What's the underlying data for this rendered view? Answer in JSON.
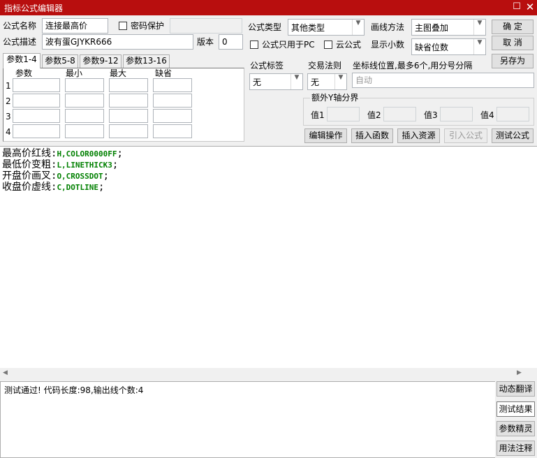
{
  "window": {
    "title": "指标公式编辑器"
  },
  "form": {
    "name_label": "公式名称",
    "name_value": "连接最高价",
    "password_label": "密码保护",
    "desc_label": "公式描述",
    "desc_value": "波有蛋GJYKR666",
    "version_label": "版本",
    "version_value": "0",
    "type_label": "公式类型",
    "type_value": "其他类型",
    "draw_label": "画线方法",
    "draw_value": "主图叠加",
    "pc_only_label": "公式只用于PC",
    "cloud_label": "云公式",
    "decimals_label": "显示小数",
    "decimals_value": "缺省位数",
    "tag_label": "公式标签",
    "tag_value": "无",
    "trade_label": "交易法则",
    "trade_value": "无",
    "coord_label": "坐标线位置,最多6个,用分号分隔",
    "coord_placeholder": "自动",
    "yaxis_label": "额外Y轴分界",
    "val1": "值1",
    "val2": "值2",
    "val3": "值3",
    "val4": "值4"
  },
  "buttons": {
    "ok": "确  定",
    "cancel": "取  消",
    "save_as": "另存为",
    "edit_op": "编辑操作",
    "insert_func": "插入函数",
    "insert_res": "插入资源",
    "import": "引入公式",
    "test": "测试公式"
  },
  "tabs": [
    "参数1-4",
    "参数5-8",
    "参数9-12",
    "参数13-16"
  ],
  "params": {
    "headers": [
      "参数",
      "最小",
      "最大",
      "缺省"
    ],
    "rows": [
      "1",
      "2",
      "3",
      "4"
    ]
  },
  "code": [
    {
      "name": "最高价红线",
      "sep": ":",
      "val": "H,COLOR0000FF",
      "end": ";"
    },
    {
      "name": "最低价变粗",
      "sep": ":",
      "val": "L,LINETHICK3",
      "end": ";"
    },
    {
      "name": "开盘价画叉",
      "sep": ":",
      "val": "O,CROSSDOT",
      "end": ";"
    },
    {
      "name": "收盘价虚线",
      "sep": ":",
      "val": "C,DOTLINE",
      "end": ";"
    }
  ],
  "result": {
    "text": "测试通过! 代码长度:98,输出线个数:4"
  },
  "side": [
    "动态翻译",
    "测试结果",
    "参数精灵",
    "用法注释"
  ]
}
